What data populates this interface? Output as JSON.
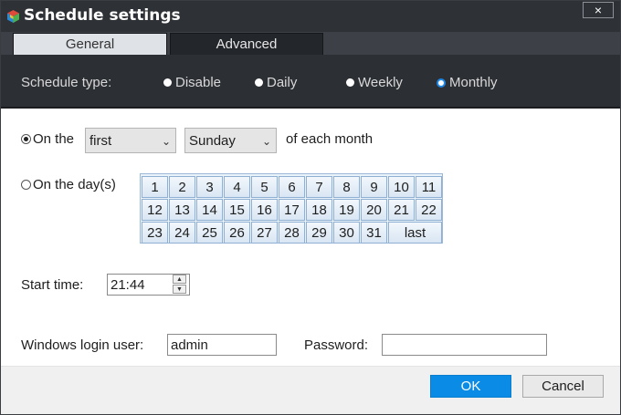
{
  "window": {
    "title": "Schedule settings",
    "close_glyph": "×"
  },
  "tabs": [
    {
      "label": "General",
      "selected": true
    },
    {
      "label": "Advanced",
      "selected": false
    }
  ],
  "schedule_type": {
    "label": "Schedule type:",
    "options": [
      "Disable",
      "Daily",
      "Weekly",
      "Monthly"
    ],
    "selected": "Monthly"
  },
  "monthly": {
    "on_the_label": "On the",
    "ordinal_select": "first",
    "weekday_select": "Sunday",
    "suffix": "of each month",
    "on_days_label": "On the day(s)",
    "mode_selected": "on_the",
    "days_row1": [
      "1",
      "2",
      "3",
      "4",
      "5",
      "6",
      "7",
      "8",
      "9",
      "10",
      "11"
    ],
    "days_row2": [
      "12",
      "13",
      "14",
      "15",
      "16",
      "17",
      "18",
      "19",
      "20",
      "21",
      "22"
    ],
    "days_row3": [
      "23",
      "24",
      "25",
      "26",
      "27",
      "28",
      "29",
      "30",
      "31",
      "last"
    ]
  },
  "start_time": {
    "label": "Start time:",
    "value": "21:44"
  },
  "login": {
    "user_label": "Windows login user:",
    "user_value": "admin",
    "password_label": "Password:",
    "password_value": ""
  },
  "buttons": {
    "ok": "OK",
    "cancel": "Cancel"
  },
  "colors": {
    "accent": "#0a8ce6",
    "titlebar": "#2e3136",
    "typebar": "#2c2f34"
  }
}
